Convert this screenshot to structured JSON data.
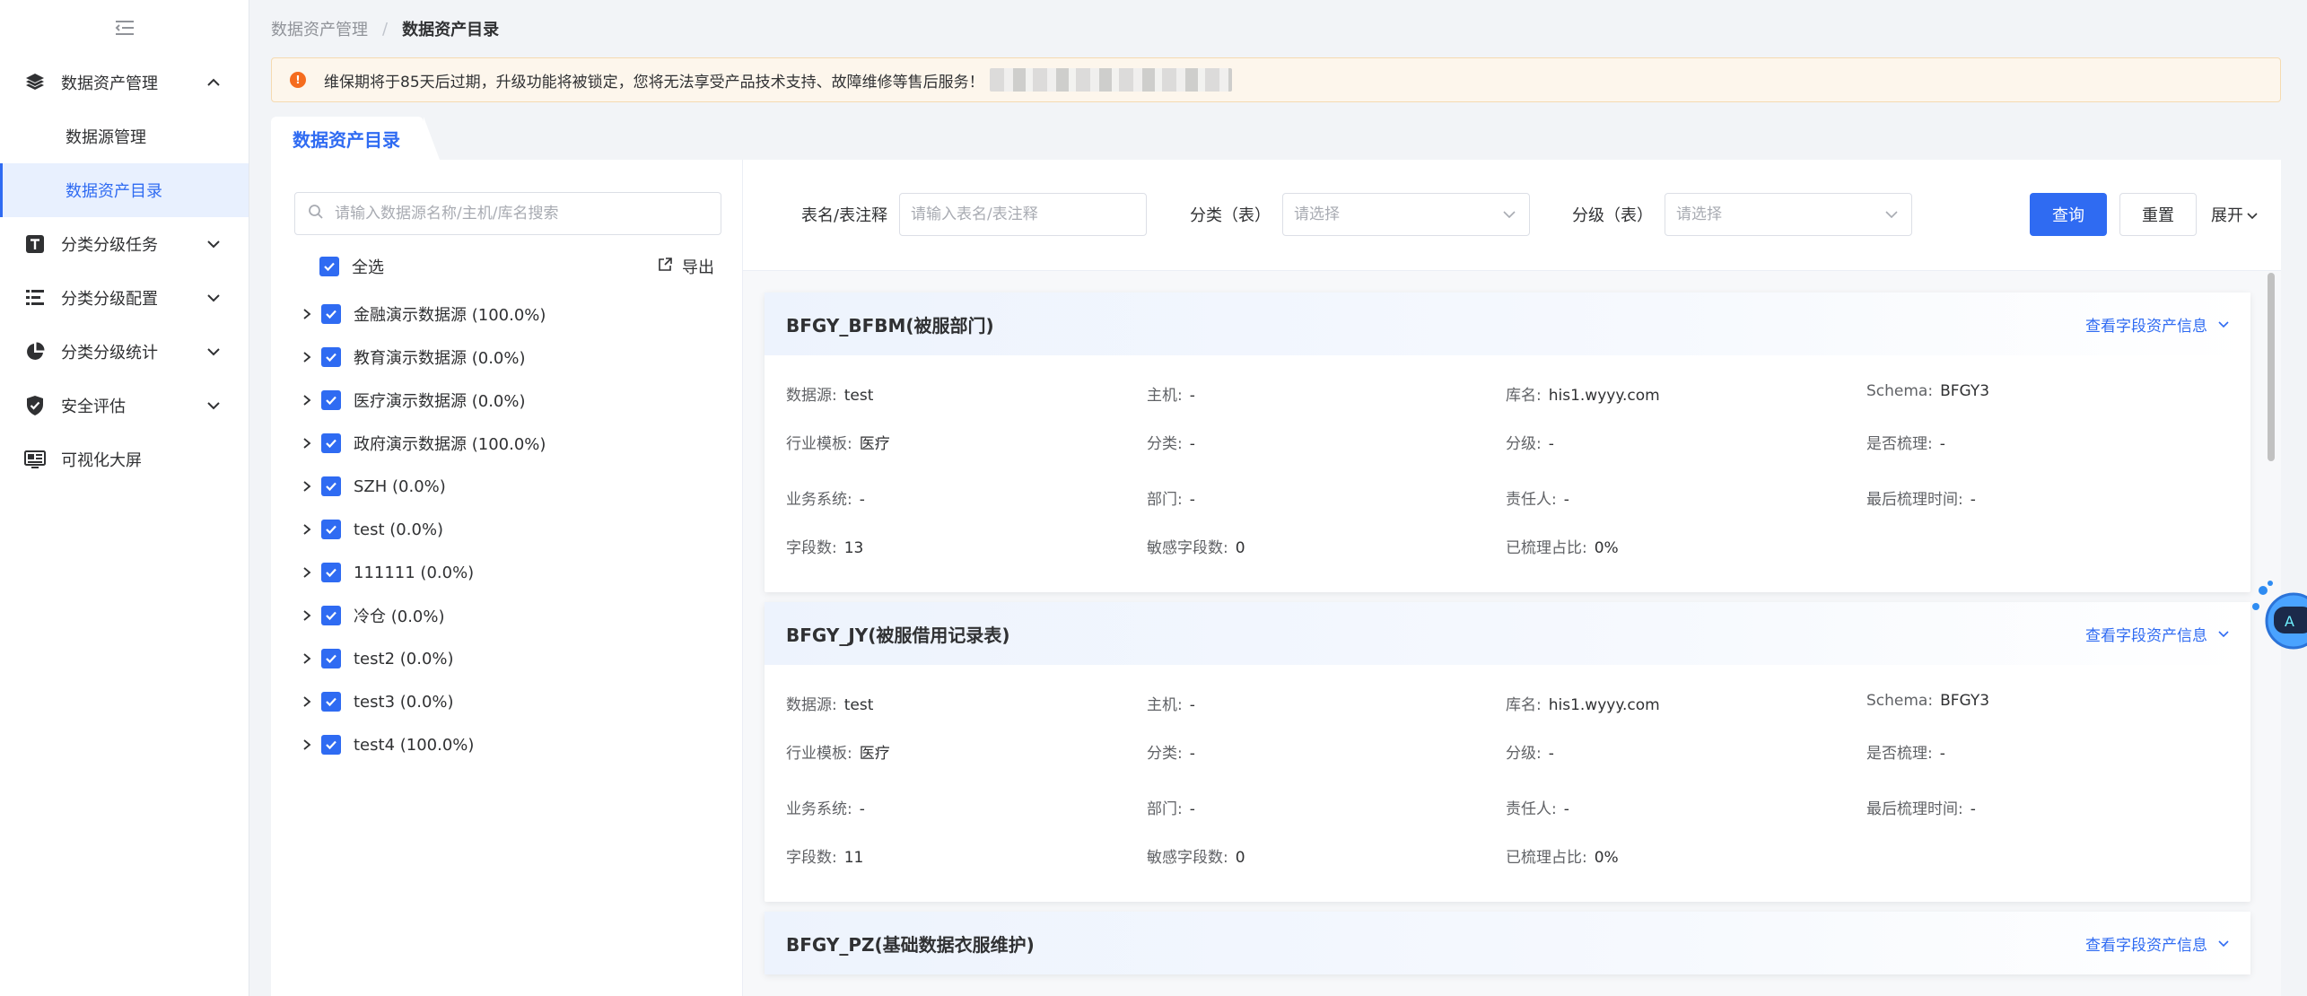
{
  "sidebar": {
    "items": [
      {
        "label": "数据资产管理",
        "icon": "layers-icon",
        "expanded": true
      },
      {
        "label": "分类分级任务",
        "icon": "text-t-icon",
        "expanded": false
      },
      {
        "label": "分类分级配置",
        "icon": "list-config-icon",
        "expanded": false
      },
      {
        "label": "分类分级统计",
        "icon": "pie-chart-icon",
        "expanded": false
      },
      {
        "label": "安全评估",
        "icon": "shield-check-icon",
        "expanded": false
      },
      {
        "label": "可视化大屏",
        "icon": "screen-icon"
      }
    ],
    "sub_items": [
      {
        "label": "数据源管理",
        "active": false
      },
      {
        "label": "数据资产目录",
        "active": true
      }
    ]
  },
  "breadcrumb": {
    "parent": "数据资产管理",
    "separator": "/",
    "current": "数据资产目录"
  },
  "alert": {
    "text": "维保期将于85天后过期，升级功能将被锁定，您将无法享受产品技术支持、故障维修等售后服务！"
  },
  "tab": {
    "label": "数据资产目录"
  },
  "left_panel": {
    "search_placeholder": "请输入数据源名称/主机/库名搜索",
    "select_all_label": "全选",
    "export_label": "导出",
    "tree": [
      "金融演示数据源 (100.0%)",
      "教育演示数据源 (0.0%)",
      "医疗演示数据源 (0.0%)",
      "政府演示数据源 (100.0%)",
      "SZH (0.0%)",
      "test (0.0%)",
      "111111 (0.0%)",
      "冷仓 (0.0%)",
      "test2 (0.0%)",
      "test3 (0.0%)",
      "test4 (100.0%)"
    ]
  },
  "filters": {
    "table_label": "表名/表注释",
    "table_placeholder": "请输入表名/表注释",
    "category_label": "分类（表）",
    "category_placeholder": "请选择",
    "grade_label": "分级（表）",
    "grade_placeholder": "请选择",
    "query_label": "查询",
    "reset_label": "重置",
    "expand_label": "展开"
  },
  "card_link_label": "查看字段资产信息",
  "field_labels": {
    "source": "数据源:",
    "host": "主机:",
    "db": "库名:",
    "schema": "Schema:",
    "industry": "行业模板:",
    "category": "分类:",
    "grade": "分级:",
    "sorted": "是否梳理:",
    "system": "业务系统:",
    "dept": "部门:",
    "owner": "责任人:",
    "last_time": "最后梳理时间:",
    "field_count": "字段数:",
    "sensitive_count": "敏感字段数:",
    "sorted_ratio": "已梳理占比:"
  },
  "cards": [
    {
      "title": "BFGY_BFBM(被服部门)",
      "source": "test",
      "host": "-",
      "db": "his1.wyyy.com",
      "schema": "BFGY3",
      "industry": "医疗",
      "category": "-",
      "grade": "-",
      "sorted": "-",
      "system": "-",
      "dept": "-",
      "owner": "-",
      "last_time": "-",
      "field_count": "13",
      "sensitive_count": "0",
      "sorted_ratio": "0%"
    },
    {
      "title": "BFGY_JY(被服借用记录表)",
      "source": "test",
      "host": "-",
      "db": "his1.wyyy.com",
      "schema": "BFGY3",
      "industry": "医疗",
      "category": "-",
      "grade": "-",
      "sorted": "-",
      "system": "-",
      "dept": "-",
      "owner": "-",
      "last_time": "-",
      "field_count": "11",
      "sensitive_count": "0",
      "sorted_ratio": "0%"
    },
    {
      "title": "BFGY_PZ(基础数据衣服维护)"
    }
  ],
  "colors": {
    "primary": "#2f6bf2",
    "warning": "#f56c1e",
    "alert_bg": "#fdf6ec"
  }
}
